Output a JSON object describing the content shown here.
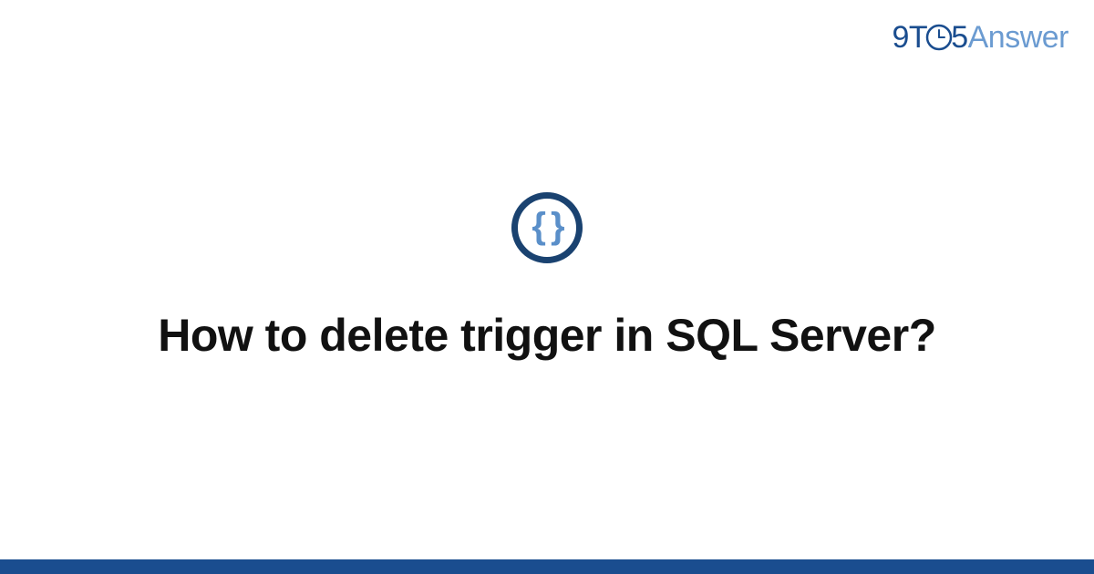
{
  "logo": {
    "part1": "9T",
    "part2": "5",
    "part3": "Answer"
  },
  "category_icon": {
    "symbol": "{ }",
    "name": "code-braces"
  },
  "question": {
    "title": "How to delete trigger in SQL Server?"
  },
  "colors": {
    "primary": "#1a4d8f",
    "secondary": "#6b9bd1",
    "icon_border": "#1a4270",
    "icon_symbol": "#5a8fc9"
  }
}
